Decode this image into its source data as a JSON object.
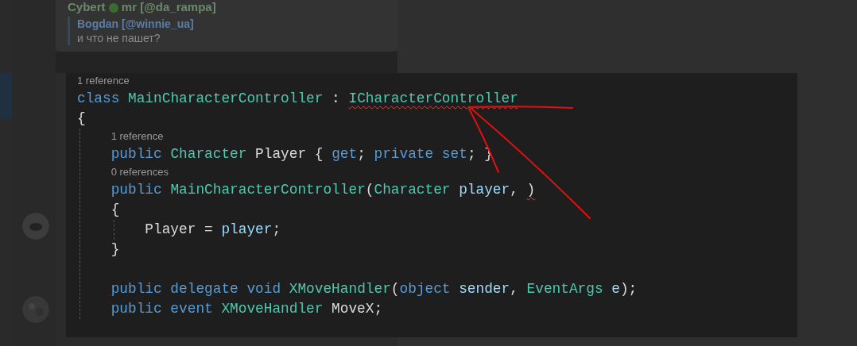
{
  "chat": {
    "sender": "Cybert",
    "sender_handle": "mr [@da_rampa]",
    "quote": {
      "author": "Bogdan [@winnie_ua]",
      "text": "и что не пашет?"
    }
  },
  "code": {
    "lines": [
      {
        "kind": "codelens",
        "text": "1 reference"
      },
      {
        "kind": "code",
        "tokens": [
          {
            "text": "class ",
            "kind": "keyword"
          },
          {
            "text": "MainCharacterController",
            "kind": "type"
          },
          {
            "text": " : ",
            "kind": "plain"
          },
          {
            "text": "ICharacterController",
            "kind": "type",
            "error": true
          }
        ]
      },
      {
        "kind": "code",
        "tokens": [
          {
            "text": "{",
            "kind": "plain"
          }
        ],
        "block": [
          {
            "kind": "codelens",
            "text": "1 reference"
          },
          {
            "kind": "code",
            "tokens": [
              {
                "text": "public ",
                "kind": "keyword"
              },
              {
                "text": "Character",
                "kind": "type"
              },
              {
                "text": " Player { ",
                "kind": "plain"
              },
              {
                "text": "get",
                "kind": "keyword"
              },
              {
                "text": "; ",
                "kind": "plain"
              },
              {
                "text": "private set",
                "kind": "keyword"
              },
              {
                "text": "; }",
                "kind": "plain"
              }
            ]
          },
          {
            "kind": "codelens",
            "text": "0 references"
          },
          {
            "kind": "code",
            "tokens": [
              {
                "text": "public ",
                "kind": "keyword"
              },
              {
                "text": "MainCharacterController",
                "kind": "type"
              },
              {
                "text": "(",
                "kind": "plain"
              },
              {
                "text": "Character",
                "kind": "type"
              },
              {
                "text": " player",
                "kind": "parameter"
              },
              {
                "text": ", ",
                "kind": "plain"
              },
              {
                "text": ")",
                "kind": "plain",
                "error": true
              }
            ]
          },
          {
            "kind": "code",
            "tokens": [
              {
                "text": "{",
                "kind": "plain"
              }
            ],
            "block": [
              {
                "kind": "code",
                "tokens": [
                  {
                    "text": "Player = ",
                    "kind": "plain"
                  },
                  {
                    "text": "player",
                    "kind": "parameter"
                  },
                  {
                    "text": ";",
                    "kind": "plain"
                  }
                ]
              }
            ]
          },
          {
            "kind": "code",
            "tokens": [
              {
                "text": "}",
                "kind": "plain"
              }
            ]
          },
          {
            "kind": "blank"
          },
          {
            "kind": "code",
            "tokens": [
              {
                "text": "public delegate void ",
                "kind": "keyword"
              },
              {
                "text": "XMoveHandler",
                "kind": "type"
              },
              {
                "text": "(",
                "kind": "plain"
              },
              {
                "text": "object",
                "kind": "keyword"
              },
              {
                "text": " sender",
                "kind": "parameter"
              },
              {
                "text": ", ",
                "kind": "plain"
              },
              {
                "text": "EventArgs",
                "kind": "type"
              },
              {
                "text": " e",
                "kind": "parameter"
              },
              {
                "text": ");",
                "kind": "plain"
              }
            ]
          },
          {
            "kind": "code",
            "tokens": [
              {
                "text": "public event ",
                "kind": "keyword"
              },
              {
                "text": "XMoveHandler",
                "kind": "type"
              },
              {
                "text": " MoveX;",
                "kind": "plain"
              }
            ]
          }
        ]
      }
    ]
  }
}
